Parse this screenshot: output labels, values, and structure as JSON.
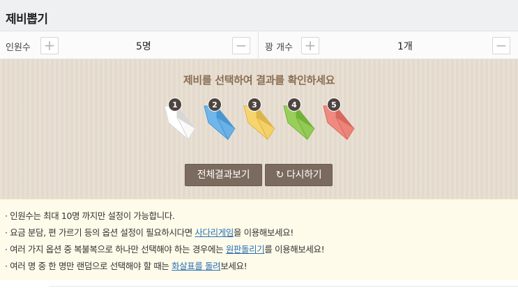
{
  "page": {
    "title": "제비뽑기"
  },
  "controls": {
    "people": {
      "label": "인원수",
      "value": "5명",
      "plus": "+",
      "minus": "−"
    },
    "winners": {
      "label": "꽝 개수",
      "value": "1개",
      "plus": "+",
      "minus": "−"
    }
  },
  "board": {
    "instruction": "제비를 선택하여 결과를 확인하세요",
    "lots": [
      {
        "number": "1",
        "color": "#ffffff",
        "edge": "#d7d7d7"
      },
      {
        "number": "2",
        "color": "#6fb6ea",
        "edge": "#4a96d1"
      },
      {
        "number": "3",
        "color": "#f7d56e",
        "edge": "#deb54a"
      },
      {
        "number": "4",
        "color": "#98cf5a",
        "edge": "#74b13b"
      },
      {
        "number": "5",
        "color": "#f08a80",
        "edge": "#d8685e"
      }
    ],
    "buttons": {
      "show_all": "전체결과보기",
      "retry": "다시하기",
      "retry_icon": "↻"
    }
  },
  "info": {
    "line1": "· 인원수는 최대 10명 까지만 설정이 가능합니다.",
    "line2": {
      "pre": "· 요금 분담, 편 가르기 등의 옵션 설정이 필요하시다면 ",
      "link": "사다리게임",
      "post": "을 이용해보세요!"
    },
    "line3": {
      "pre": "· 여러 가지 옵션 중 복불복으로 하나만 선택해야 하는 경우에는 ",
      "link": "원판돌리기",
      "post": "를 이용해보세요!"
    },
    "line4": {
      "pre": "· 여러 명 중 한 명만 랜덤으로 선택해야 할 때는 ",
      "link": "화살표를 돌려",
      "post": "보세요!"
    }
  }
}
